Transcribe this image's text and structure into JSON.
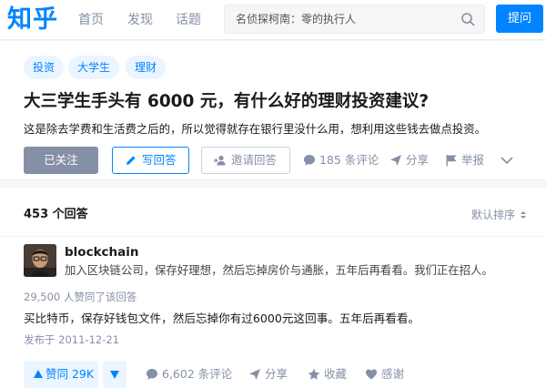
{
  "header": {
    "logo": "知乎",
    "nav": [
      "首页",
      "发现",
      "话题"
    ],
    "search_placeholder": "名侦探柯南：零的执行人",
    "ask_label": "提问"
  },
  "question": {
    "tags": [
      "投资",
      "大学生",
      "理财"
    ],
    "title": "大三学生手头有 6000 元，有什么好的理财投资建议?",
    "description": "这是除去学费和生活费之后的，所以觉得就存在银行里没什么用，想利用这些钱去做点投资。",
    "follow_label": "已关注",
    "write_label": "写回答",
    "invite_label": "邀请回答",
    "comments_label": "185 条评论",
    "share_label": "分享",
    "report_label": "举报"
  },
  "answers": {
    "count_label": "453 个回答",
    "sort_label": "默认排序",
    "items": [
      {
        "author": "blockchain",
        "bio": "加入区块链公司，保存好理想，然后忘掉房价与通胀，五年后再看看。我们正在招人。",
        "votes_text": "29,500 人赞同了该回答",
        "content": "买比特币，保存好钱包文件，然后忘掉你有过6000元这回事。五年后再看看。",
        "date": "发布于 2011-12-21",
        "upvote_label": "赞同 29K",
        "comments_label": "6,602 条评论",
        "share_label": "分享",
        "favorite_label": "收藏",
        "thanks_label": "感谢"
      }
    ]
  },
  "colors": {
    "brand": "#0084ff",
    "muted": "#8590a6",
    "tag_bg": "#ebf5ff"
  }
}
